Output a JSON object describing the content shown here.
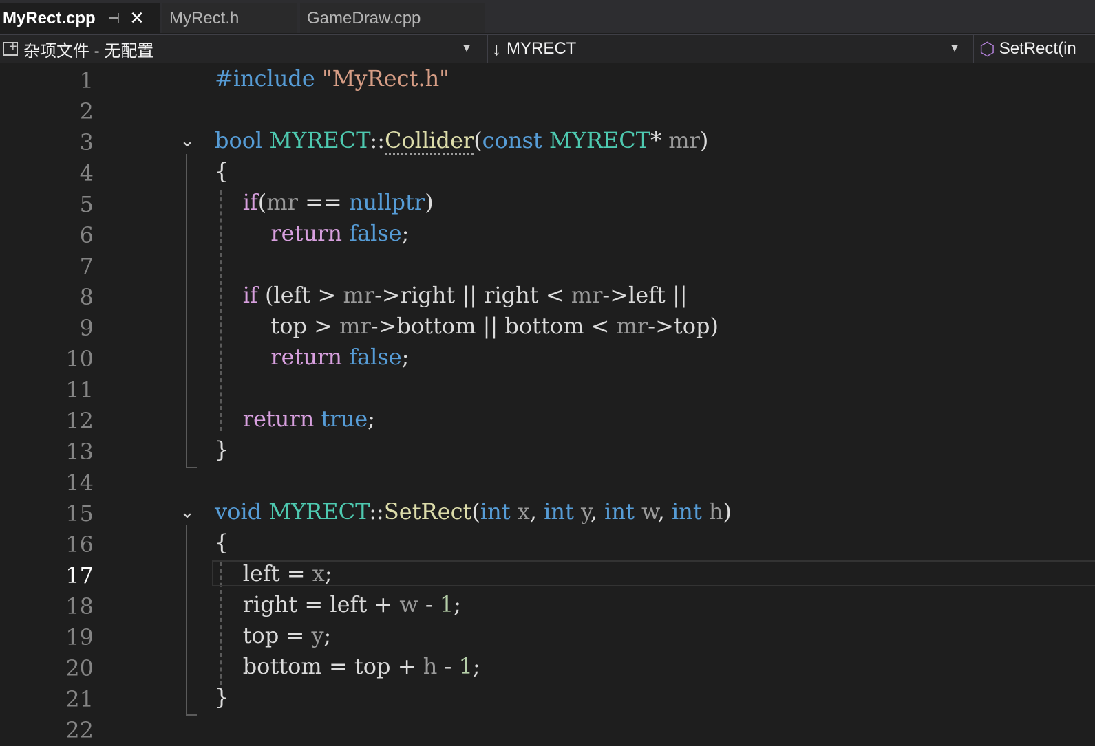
{
  "tabs": [
    {
      "label": "MyRect.cpp",
      "active": true,
      "pinned": true
    },
    {
      "label": "MyRect.h",
      "active": false
    },
    {
      "label": "GameDraw.cpp",
      "active": false
    }
  ],
  "navbar": {
    "project": "杂项文件 - 无配置",
    "scope": "MYRECT",
    "member": "SetRect(in"
  },
  "editor": {
    "current_line": 17,
    "line_numbers": [
      "1",
      "2",
      "3",
      "4",
      "5",
      "6",
      "7",
      "8",
      "9",
      "10",
      "11",
      "12",
      "13",
      "14",
      "15",
      "16",
      "17",
      "18",
      "19",
      "20",
      "21",
      "22"
    ],
    "tokens": {
      "include": "#include",
      "include_file": "\"MyRect.h\"",
      "bool": "bool",
      "void": "void",
      "class": "MYRECT",
      "scope_op": "::",
      "collider": "Collider",
      "setrect": "SetRect",
      "const": "const",
      "nullptr": "nullptr",
      "if": "if",
      "return": "return",
      "false": "false",
      "true": "true",
      "int": "int",
      "mr": "mr",
      "left": "left",
      "right": "right",
      "top": "top",
      "bottom": "bottom",
      "x": "x",
      "y": "y",
      "w": "w",
      "h": "h",
      "one": "1"
    }
  },
  "colors": {
    "background": "#1e1e1e",
    "keyword": "#569cd6",
    "control": "#d8a0df",
    "type": "#4ec9b0",
    "function": "#dcdcaa",
    "string": "#d69d85",
    "line_number": "#858585"
  }
}
